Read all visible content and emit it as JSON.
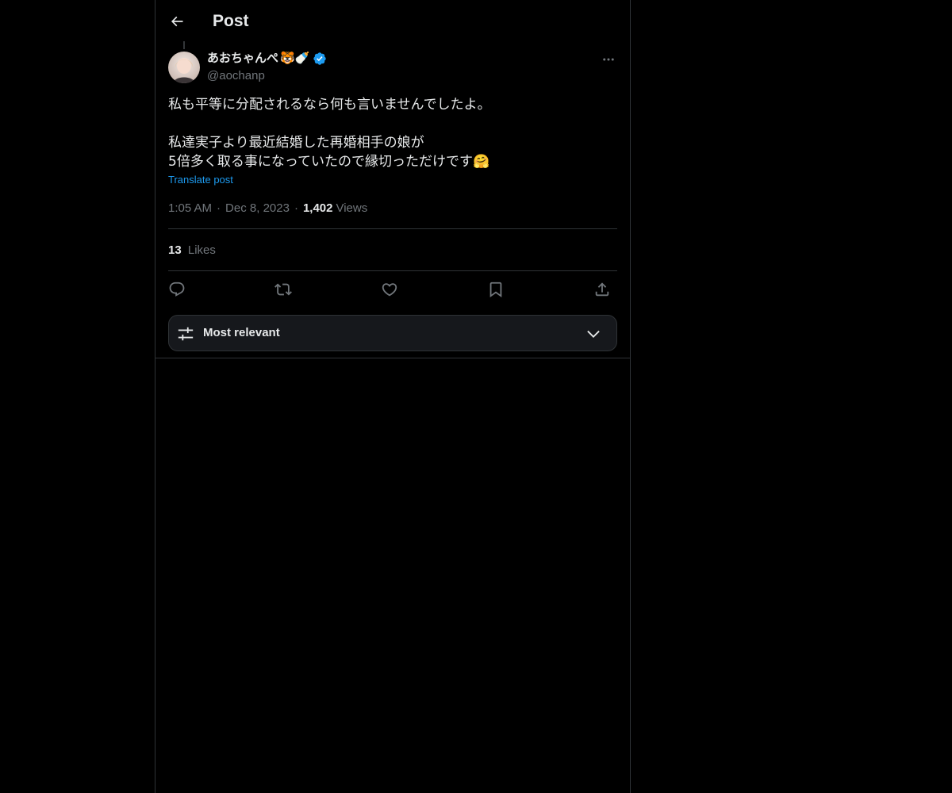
{
  "header": {
    "title": "Post",
    "back_icon": "arrow-left-icon"
  },
  "post": {
    "author": {
      "display_name": "あおちゃんぺ",
      "name_emoji": "🐯🍼",
      "handle": "@aochanp",
      "verified": true,
      "verified_color": "#1d9bf0"
    },
    "text_lines": [
      "私も平等に分配されるなら何も言いませんでしたよ。",
      "",
      "私達実子より最近結婚した再婚相手の娘が",
      "5倍多く取る事になっていたので縁切っただけです🤗"
    ],
    "translate_label": "Translate post",
    "time": "1:05 AM",
    "date": "Dec 8, 2023",
    "views_count": "1,402",
    "views_label": "Views",
    "separator": "·",
    "likes_count": "13",
    "likes_label": "Likes"
  },
  "actions": {
    "reply": "reply-icon",
    "repost": "repost-icon",
    "like": "heart-icon",
    "bookmark": "bookmark-icon",
    "share": "share-icon"
  },
  "sort": {
    "label": "Most relevant"
  },
  "colors": {
    "background": "#000000",
    "text_primary": "#e7e9ea",
    "text_secondary": "#71767b",
    "accent": "#1d9bf0",
    "border": "#2f3336"
  }
}
